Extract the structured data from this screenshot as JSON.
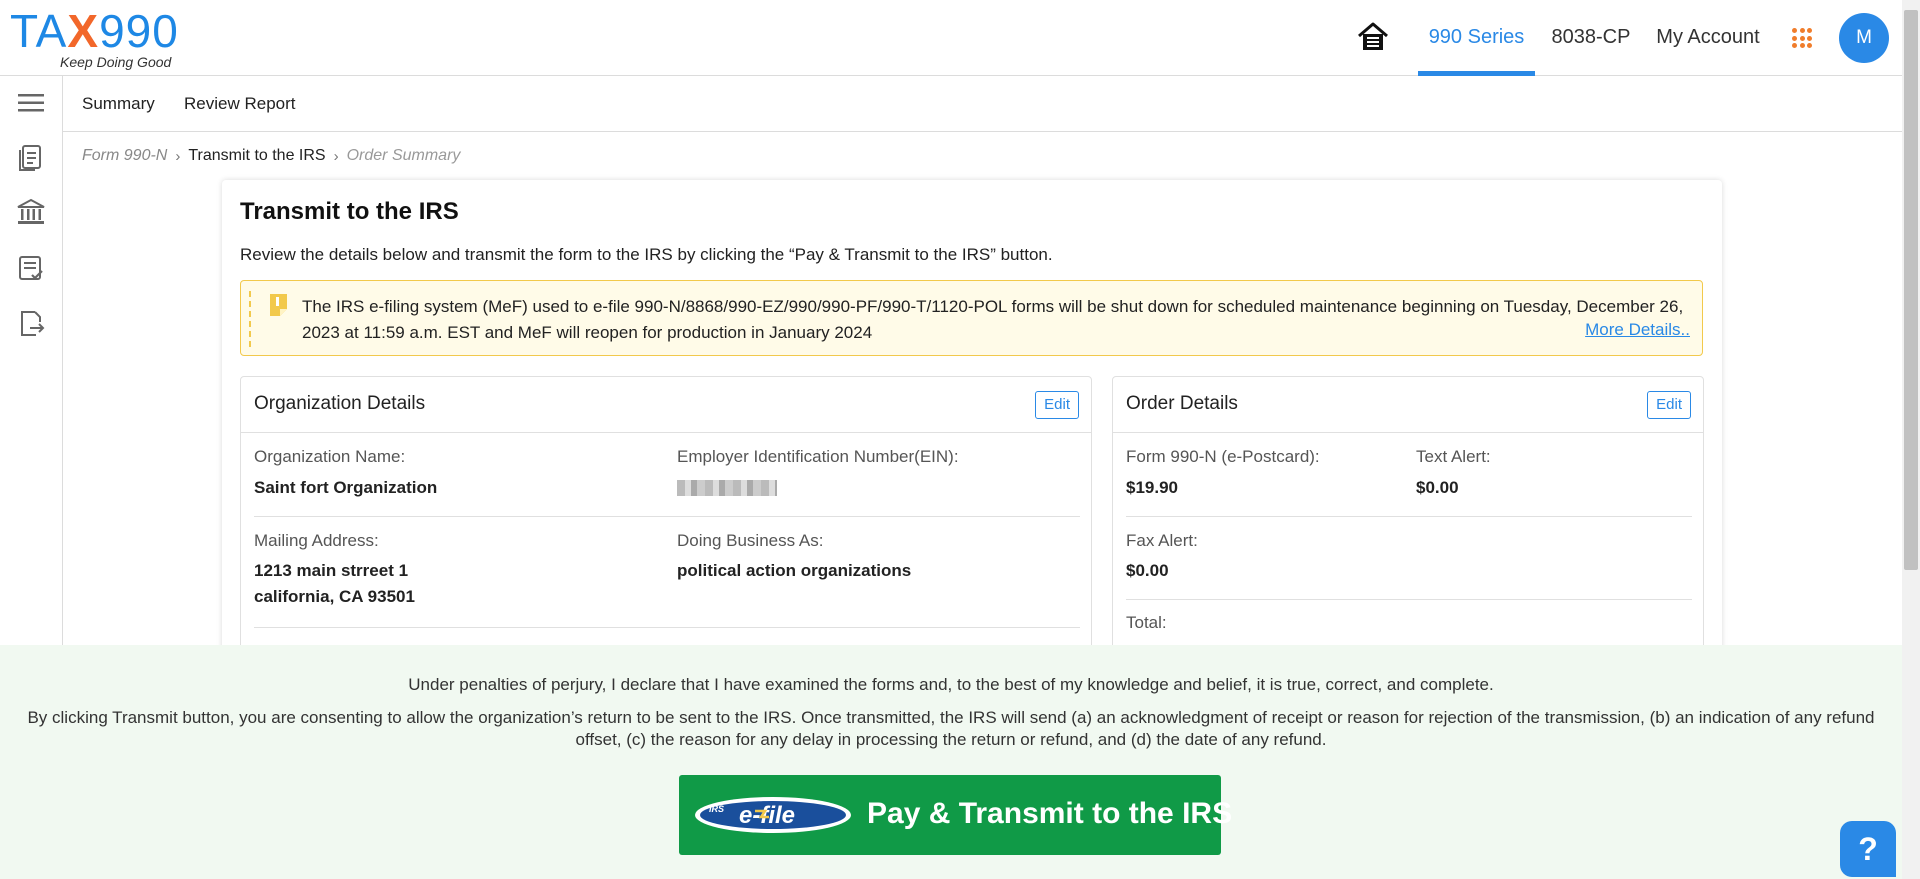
{
  "header": {
    "logo_text": "TAX990",
    "logo_tagline": "Keep Doing Good",
    "nav": [
      {
        "label": "990 Series",
        "active": true
      },
      {
        "label": "8038-CP",
        "active": false
      },
      {
        "label": "My Account",
        "active": false
      }
    ],
    "avatar_initial": "M",
    "accent_color": "#2a89e6"
  },
  "siderail": {
    "icons": [
      "menu-icon",
      "document-icon",
      "bank-icon",
      "checklist-icon",
      "export-document-icon"
    ]
  },
  "subnav": {
    "items": [
      "Summary",
      "Review Report"
    ]
  },
  "breadcrumb": {
    "items": [
      "Form 990-N",
      "Transmit to the IRS",
      "Order Summary"
    ]
  },
  "main": {
    "title": "Transmit to the IRS",
    "description": "Review the details below and transmit the form to the IRS by clicking the “Pay & Transmit to the IRS” button.",
    "alert": {
      "text": "The IRS e-filing system (MeF) used to e-file 990-N/8868/990-EZ/990/990-PF/990-T/1120-POL forms will be shut down for scheduled maintenance beginning on Tuesday, December 26, 2023 at 11:59 a.m. EST and MeF will reopen for production in January 2024",
      "link": "More Details.."
    }
  },
  "org_details": {
    "title": "Organization Details",
    "edit_label": "Edit",
    "org_name_label": "Organization Name:",
    "org_name": "Saint fort Organization",
    "ein_label": "Employer Identification Number(EIN):",
    "mailing_label": "Mailing Address:",
    "mailing_line1": "1213 main strreet 1",
    "mailing_line2": "california, CA 93501",
    "dba_label": "Doing Business As:",
    "dba": "political action organizations"
  },
  "order_details": {
    "title": "Order Details",
    "edit_label": "Edit",
    "form_label": "Form 990-N (e-Postcard):",
    "form_value": "$19.90",
    "text_alert_label": "Text Alert:",
    "text_alert_value": "$0.00",
    "fax_alert_label": "Fax Alert:",
    "fax_alert_value": "$0.00",
    "total_label": "Total:"
  },
  "footer": {
    "declaration": "Under penalties of perjury, I declare that I have examined the forms and, to the best of my knowledge and belief, it is true, correct, and complete.",
    "consent": "By clicking Transmit button, you are consenting to allow the organization’s return to be sent to the IRS. Once transmitted, the IRS will send (a) an acknowledgment of receipt or reason for rejection of the transmission, (b) an indication of any refund offset, (c) the reason for any delay in processing the return or refund, and (d) the date of any refund.",
    "button_label": "Pay & Transmit to the IRS",
    "efile_logo_text": "e-file",
    "efile_logo_irs": "IRS",
    "button_color": "#109a47"
  },
  "help": {
    "label": "?"
  }
}
